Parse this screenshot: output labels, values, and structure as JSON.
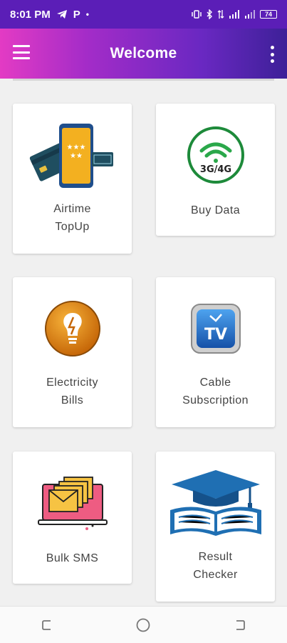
{
  "status_bar": {
    "time": "8:01 PM",
    "p_label": "P",
    "dot": "•",
    "battery": "74"
  },
  "app_bar": {
    "title": "Welcome"
  },
  "icons": {
    "menu": "hamburger-menu-icon",
    "more": "more-vertical-icon"
  },
  "cards": [
    {
      "label": "Airtime\nTopUp",
      "icon": "airtime-topup-icon"
    },
    {
      "label": "Buy Data",
      "icon": "buy-data-3g-4g-icon",
      "icon_text": "3G/4G"
    },
    {
      "label": "Electricity\nBills",
      "icon": "electricity-bulb-icon"
    },
    {
      "label": "Cable\nSubscription",
      "icon": "cable-tv-icon",
      "icon_text": "TV"
    },
    {
      "label": "Bulk SMS",
      "icon": "bulk-sms-envelopes-icon"
    },
    {
      "label": "Result\nChecker",
      "icon": "graduation-cap-book-icon"
    }
  ],
  "colors": {
    "status_bar": "#5b1eb7",
    "app_bar_start": "#e33bc4",
    "app_bar_end": "#3d2098",
    "background": "#f0f0f0",
    "card": "#ffffff",
    "label_text": "#444444"
  }
}
